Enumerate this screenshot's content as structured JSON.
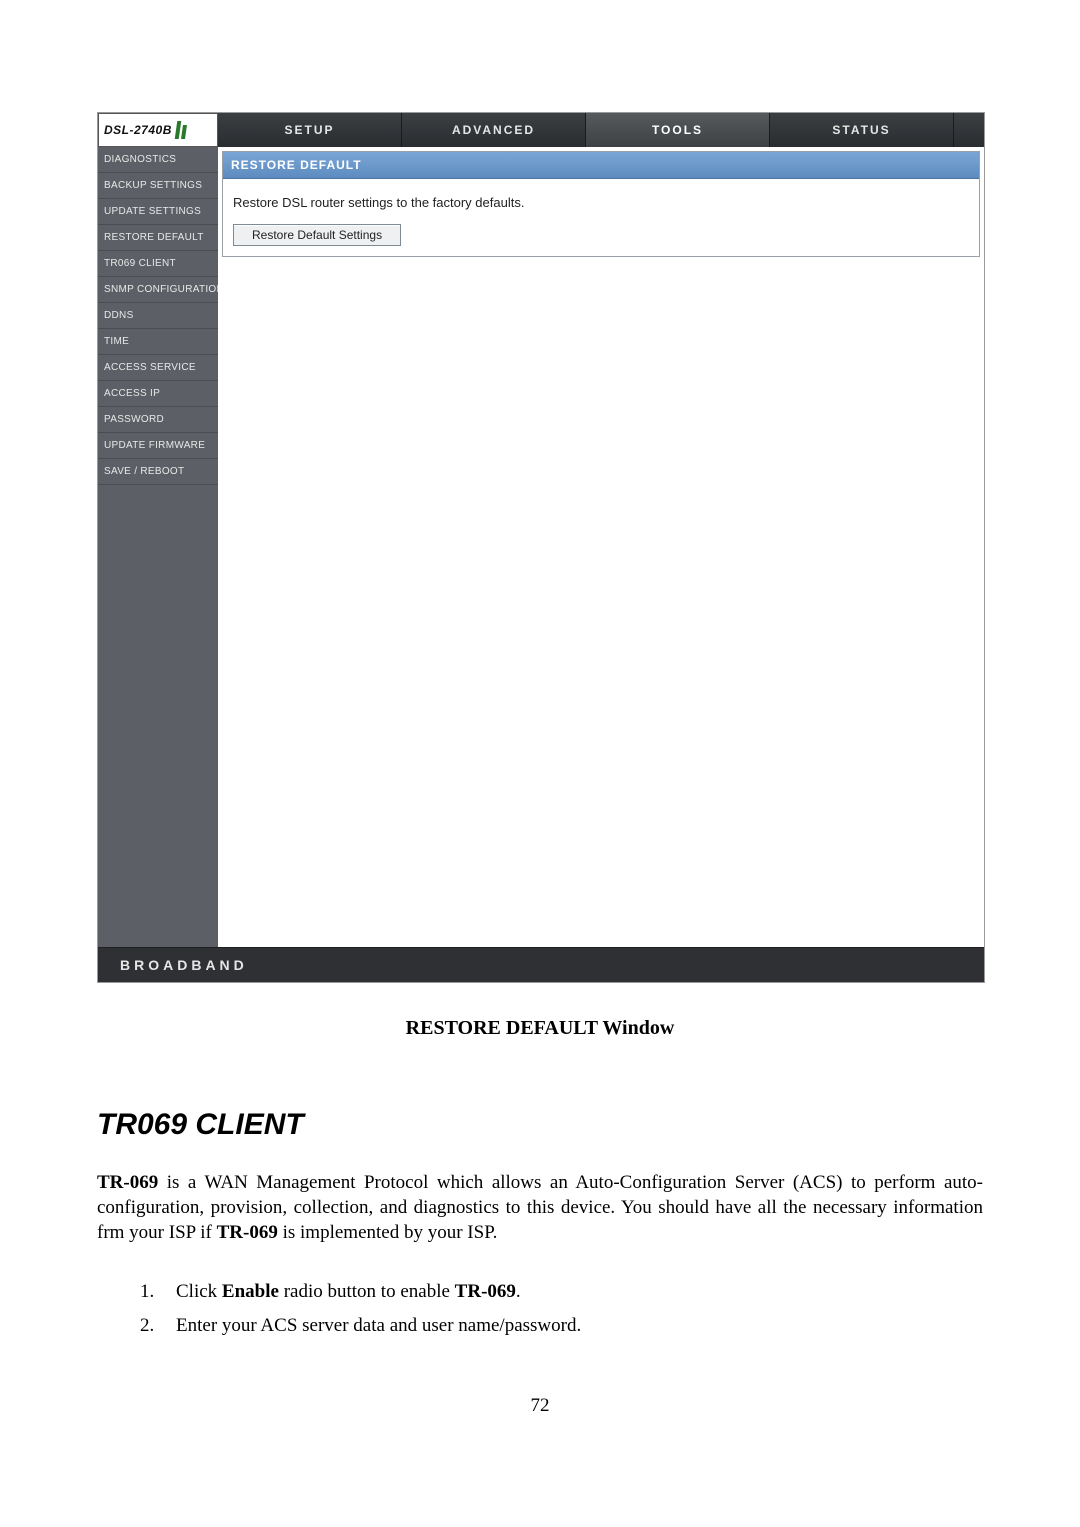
{
  "router_ui": {
    "logo": "DSL-2740B",
    "tabs": [
      "SETUP",
      "ADVANCED",
      "TOOLS",
      "STATUS"
    ],
    "active_tab": "TOOLS",
    "sidebar": [
      "DIAGNOSTICS",
      "BACKUP SETTINGS",
      "UPDATE SETTINGS",
      "RESTORE DEFAULT",
      "TR069 CLIENT",
      "SNMP CONFIGURATION",
      "DDNS",
      "TIME",
      "ACCESS SERVICE",
      "ACCESS IP",
      "PASSWORD",
      "UPDATE FIRMWARE",
      "SAVE / REBOOT"
    ],
    "panel": {
      "title": "RESTORE DEFAULT",
      "description": "Restore DSL router settings to the factory defaults.",
      "button_label": "Restore Default Settings"
    },
    "footer": "BROADBAND"
  },
  "doc": {
    "caption": "RESTORE DEFAULT Window",
    "heading": "TR069 CLIENT",
    "paragraph": {
      "lead_term": "TR-069",
      "body1": " is a WAN Management Protocol which allows an Auto-Configuration Server (ACS) to perform auto-configuration, provision, collection, and diagnostics to this device. You should have all the necessary information frm your ISP if ",
      "bold2": "TR-069",
      "body2": " is implemented by your ISP."
    },
    "list": {
      "num1": "1.",
      "item1_a": "Click ",
      "item1_b": "Enable",
      "item1_c": " radio button to enable ",
      "item1_d": "TR-069",
      "item1_e": ".",
      "num2": "2.",
      "item2": "Enter your ACS server data and user name/password."
    },
    "page_number": "72"
  }
}
